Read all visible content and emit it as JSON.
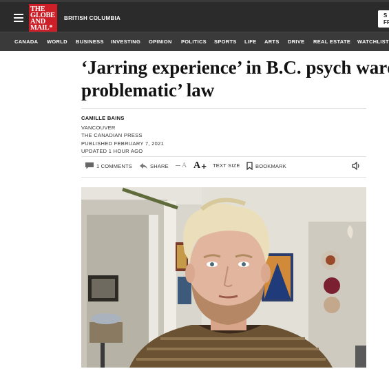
{
  "header": {
    "logo_lines": [
      "THE",
      "GLOBE",
      "AND",
      "MAIL*"
    ],
    "section": "BRITISH COLUMBIA",
    "signin_lines": [
      "S",
      "FR"
    ]
  },
  "nav": {
    "items": [
      "CANADA",
      "WORLD",
      "BUSINESS",
      "INVESTING",
      "OPINION",
      "POLITICS",
      "SPORTS",
      "LIFE",
      "ARTS",
      "DRIVE",
      "REAL ESTATE",
      "WATCHLIST"
    ]
  },
  "article": {
    "headline_line1": "‘Jarring experience’ in B.C. psych ward",
    "headline_line2": "problematic’ law",
    "author": "CAMILLE BAINS",
    "location": "VANCOUVER",
    "source": "THE CANADIAN PRESS",
    "published": "PUBLISHED FEBRUARY 7, 2021",
    "updated": "UPDATED 1 HOUR AGO"
  },
  "tools": {
    "comments": "1 COMMENTS",
    "share": "SHARE",
    "text_minus": "A",
    "text_plus": "A",
    "text_size": "TEXT SIZE",
    "bookmark": "BOOKMARK"
  },
  "icons": [
    "menu-icon",
    "comment-icon",
    "share-icon",
    "text-decrease-icon",
    "text-increase-icon",
    "bookmark-icon",
    "speaker-icon"
  ],
  "colors": {
    "logo_red": "#cc1f28",
    "header_bg": "#2b2b2b",
    "nav_bg": "#3a3a3a"
  }
}
